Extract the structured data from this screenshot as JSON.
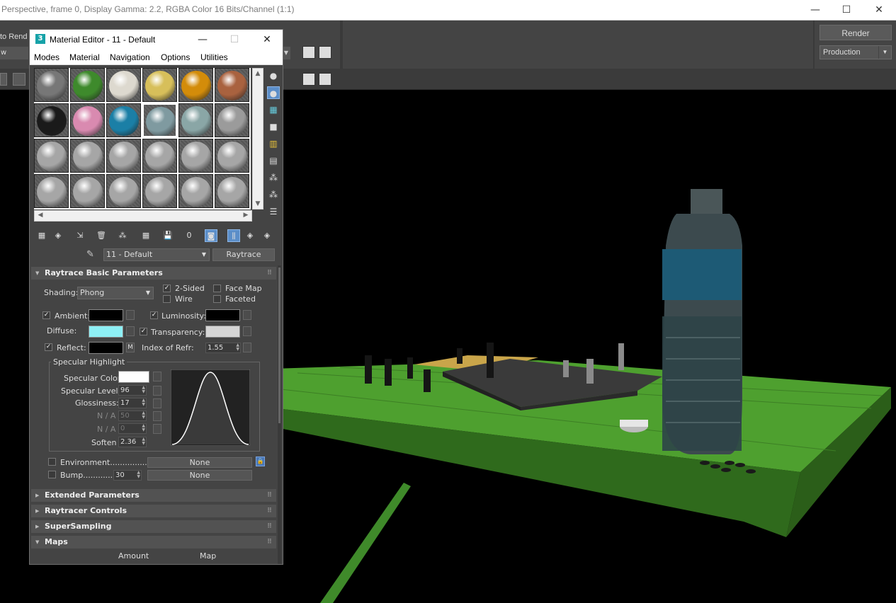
{
  "frame": {
    "title": "Perspective, frame 0, Display Gamma: 2.2, RGBA Color 16 Bits/Channel (1:1)",
    "controls": [
      "—",
      "☐",
      "✕"
    ],
    "left_label": "to Rend",
    "left_field": "w",
    "render_button": "Render",
    "render_preset": "Production"
  },
  "material_editor": {
    "title": "Material Editor - 11 - Default",
    "app_icon": "3",
    "controls": [
      "—",
      "☐",
      "✕"
    ],
    "menus": [
      "Modes",
      "Material",
      "Navigation",
      "Options",
      "Utilities"
    ],
    "slot_colors": [
      [
        "#777777",
        "#3e8a2c",
        "#ddd9cf",
        "#d7bf5a",
        "#d38c0a",
        "#a9623f"
      ],
      [
        "#1a1a1a",
        "#d98ab0",
        "#1b7fa6",
        "#7f9aa0",
        "#8aa6a6",
        "#9b9b9b"
      ],
      [
        "#a6a6a6",
        "#a6a6a6",
        "#a6a6a6",
        "#a6a6a6",
        "#a6a6a6",
        "#a6a6a6"
      ],
      [
        "#a6a6a6",
        "#a6a6a6",
        "#a6a6a6",
        "#a6a6a6",
        "#a6a6a6",
        "#a6a6a6"
      ]
    ],
    "material_name": "11 - Default",
    "material_type": "Raytrace",
    "rollouts": {
      "basic": "Raytrace Basic Parameters",
      "extended": "Extended Parameters",
      "controls": "Raytracer Controls",
      "supersampling": "SuperSampling",
      "maps": "Maps"
    },
    "shading_label": "Shading:",
    "shading_value": "Phong",
    "two_sided": "2-Sided",
    "wire": "Wire",
    "face_map": "Face Map",
    "faceted": "Faceted",
    "ambient": "Ambient:",
    "diffuse": "Diffuse:",
    "reflect": "Reflect:",
    "reflect_map": "M",
    "luminosity": "Luminosity:",
    "transparency": "Transparency:",
    "ior_label": "Index of Refr:",
    "ior_value": "1.55",
    "colors": {
      "ambient": "#000000",
      "diffuse": "#8ef0f5",
      "reflect": "#000000",
      "luminosity": "#000000",
      "transparency": "#d6d6d6",
      "specular": "#ffffff"
    },
    "specular": {
      "group_title": "Specular Highlight",
      "color_label": "Specular Color",
      "level_label": "Specular Level:",
      "level_value": "96",
      "gloss_label": "Glossiness:",
      "gloss_value": "17",
      "na1_label": "N / A",
      "na1_value": "50",
      "na2_label": "N / A",
      "na2_value": "0",
      "soften_label": "Soften",
      "soften_value": "2.36"
    },
    "environment_label": "Environment...............",
    "environment_map": "None",
    "bump_label": "Bump............",
    "bump_value": "30",
    "bump_map": "None",
    "maps_amount": "Amount",
    "maps_map": "Map"
  }
}
